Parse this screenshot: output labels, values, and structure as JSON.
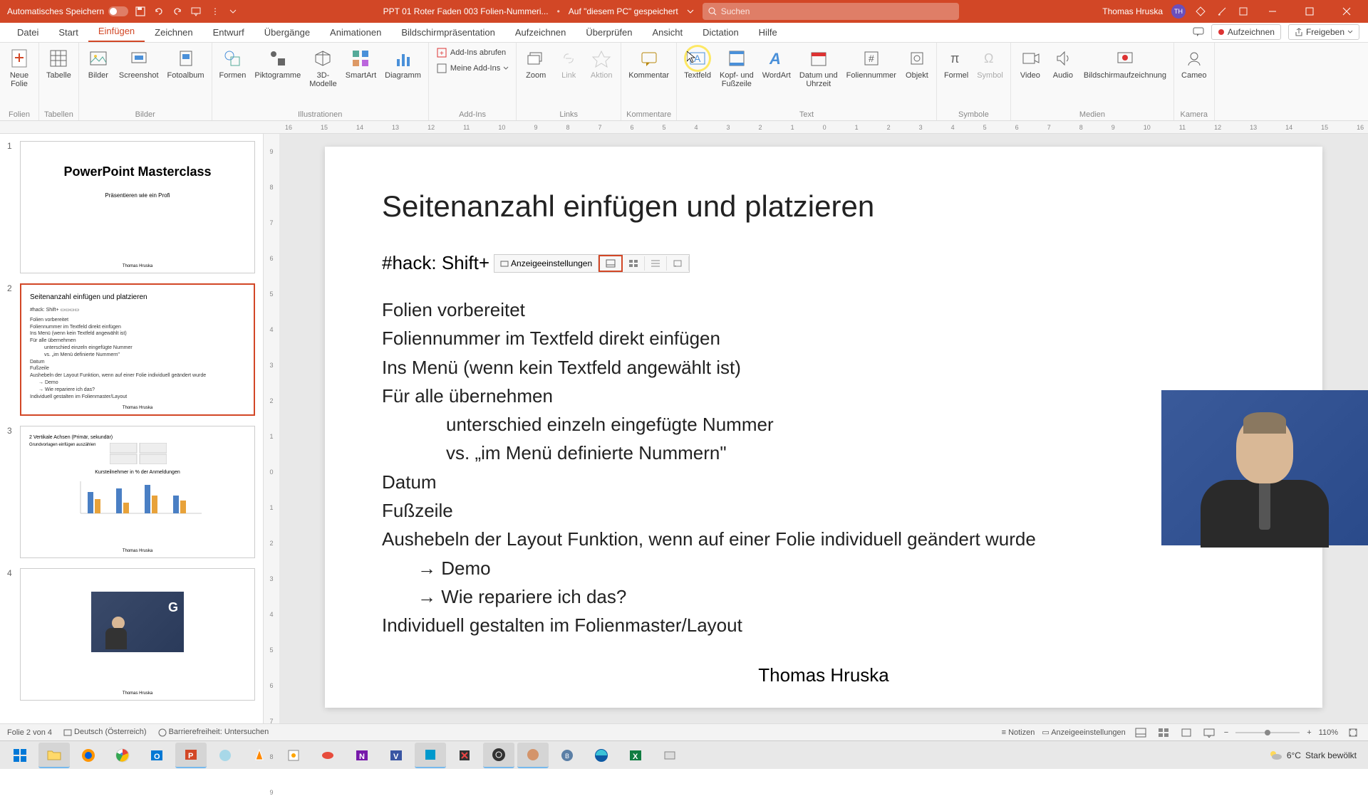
{
  "titlebar": {
    "autosave": "Automatisches Speichern",
    "filename": "PPT 01 Roter Faden 003 Folien-Nummeri...",
    "saved_location": "Auf \"diesem PC\" gespeichert",
    "search_placeholder": "Suchen",
    "user_name": "Thomas Hruska",
    "user_initials": "TH"
  },
  "tabs": {
    "datei": "Datei",
    "start": "Start",
    "einfuegen": "Einfügen",
    "zeichnen": "Zeichnen",
    "entwurf": "Entwurf",
    "uebergaenge": "Übergänge",
    "animationen": "Animationen",
    "bildschirm": "Bildschirmpräsentation",
    "aufzeichnen": "Aufzeichnen",
    "ueberpruefen": "Überprüfen",
    "ansicht": "Ansicht",
    "dictation": "Dictation",
    "hilfe": "Hilfe",
    "record_btn": "Aufzeichnen",
    "share_btn": "Freigeben"
  },
  "ribbon": {
    "neue_folie": "Neue\nFolie",
    "tabelle": "Tabelle",
    "bilder": "Bilder",
    "screenshot": "Screenshot",
    "fotoalbum": "Fotoalbum",
    "formen": "Formen",
    "piktogramme": "Piktogramme",
    "modelle3d": "3D-\nModelle",
    "smartart": "SmartArt",
    "diagramm": "Diagramm",
    "addins_abrufen": "Add-Ins abrufen",
    "meine_addins": "Meine Add-Ins",
    "zoom": "Zoom",
    "link": "Link",
    "aktion": "Aktion",
    "kommentar": "Kommentar",
    "textfeld": "Textfeld",
    "kopf_fusszeile": "Kopf- und\nFußzeile",
    "wordart": "WordArt",
    "datum_uhrzeit": "Datum und\nUhrzeit",
    "foliennummer": "Foliennummer",
    "objekt": "Objekt",
    "formel": "Formel",
    "symbol": "Symbol",
    "video": "Video",
    "audio": "Audio",
    "bildschirmaufz": "Bildschirmaufzeichnung",
    "cameo": "Cameo",
    "grp_folien": "Folien",
    "grp_tabellen": "Tabellen",
    "grp_bilder": "Bilder",
    "grp_illustrationen": "Illustrationen",
    "grp_addins": "Add-Ins",
    "grp_links": "Links",
    "grp_kommentare": "Kommentare",
    "grp_text": "Text",
    "grp_symbole": "Symbole",
    "grp_medien": "Medien",
    "grp_kamera": "Kamera"
  },
  "slide": {
    "title": "Seitenanzahl einfügen und platzieren",
    "hack_prefix": "#hack: Shift+",
    "hack_display": "Anzeigeeinstellungen",
    "body": [
      "Folien vorbereitet",
      "Foliennummer im Textfeld direkt einfügen",
      "Ins Menü (wenn kein Textfeld angewählt ist)",
      "Für alle übernehmen",
      "unterschied  einzeln eingefügte Nummer",
      "vs. „im Menü definierte Nummern\"",
      "Datum",
      "Fußzeile",
      "Aushebeln der Layout Funktion, wenn auf einer Folie individuell geändert wurde",
      "→ Demo",
      "→ Wie repariere ich das?",
      "Individuell gestalten im Folienmaster/Layout"
    ],
    "author": "Thomas Hruska"
  },
  "thumbs": {
    "t1_title": "PowerPoint Masterclass",
    "t1_sub": "Präsentieren wie ein Profi",
    "t1_author": "Thomas Hruska",
    "t2_title": "Seitenanzahl einfügen und platzieren",
    "t2_author": "Thomas Hruska",
    "t3_author": "Thomas Hruska",
    "t4_author": "Thomas Hruska"
  },
  "statusbar": {
    "slide_count": "Folie 2 von 4",
    "language": "Deutsch (Österreich)",
    "accessibility": "Barrierefreiheit: Untersuchen",
    "notizen": "Notizen",
    "anzeige": "Anzeigeeinstellungen",
    "zoom": "110%"
  },
  "taskbar": {
    "temp": "6°C",
    "weather": "Stark bewölkt"
  },
  "ruler": [
    "16",
    "15",
    "14",
    "13",
    "12",
    "11",
    "10",
    "9",
    "8",
    "7",
    "6",
    "5",
    "4",
    "3",
    "2",
    "1",
    "0",
    "1",
    "2",
    "3",
    "4",
    "5",
    "6",
    "7",
    "8",
    "9",
    "10",
    "11",
    "12",
    "13",
    "14",
    "15",
    "16"
  ],
  "rulerv": [
    "9",
    "8",
    "7",
    "6",
    "5",
    "4",
    "3",
    "2",
    "1",
    "0",
    "1",
    "2",
    "3",
    "4",
    "5",
    "6",
    "7",
    "8",
    "9"
  ]
}
